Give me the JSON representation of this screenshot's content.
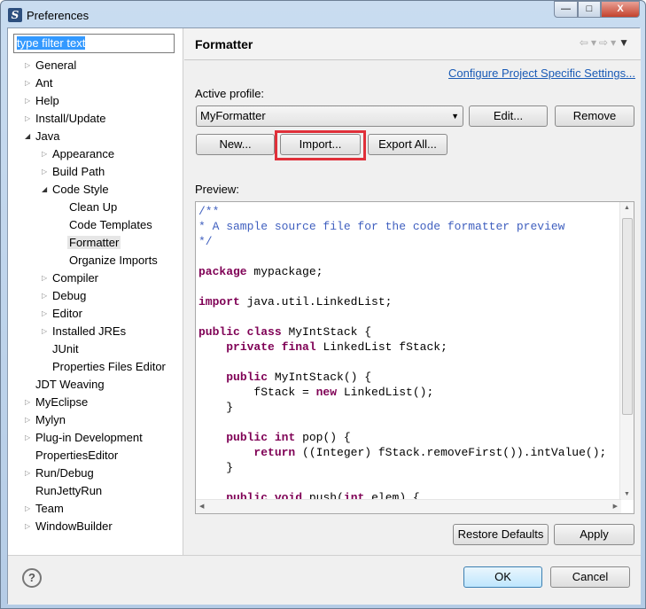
{
  "window": {
    "title": "Preferences",
    "icon": "myeclipse-icon",
    "controls": [
      "minimize",
      "maximize",
      "close"
    ]
  },
  "filter": {
    "value": "type filter text"
  },
  "tree": [
    {
      "label": "General",
      "level": 0,
      "arrow": "collapsed"
    },
    {
      "label": "Ant",
      "level": 0,
      "arrow": "collapsed"
    },
    {
      "label": "Help",
      "level": 0,
      "arrow": "collapsed"
    },
    {
      "label": "Install/Update",
      "level": 0,
      "arrow": "collapsed"
    },
    {
      "label": "Java",
      "level": 0,
      "arrow": "expanded"
    },
    {
      "label": "Appearance",
      "level": 1,
      "arrow": "collapsed"
    },
    {
      "label": "Build Path",
      "level": 1,
      "arrow": "collapsed"
    },
    {
      "label": "Code Style",
      "level": 1,
      "arrow": "expanded"
    },
    {
      "label": "Clean Up",
      "level": 2,
      "arrow": "none"
    },
    {
      "label": "Code Templates",
      "level": 2,
      "arrow": "none"
    },
    {
      "label": "Formatter",
      "level": 2,
      "arrow": "none",
      "selected": true
    },
    {
      "label": "Organize Imports",
      "level": 2,
      "arrow": "none"
    },
    {
      "label": "Compiler",
      "level": 1,
      "arrow": "collapsed"
    },
    {
      "label": "Debug",
      "level": 1,
      "arrow": "collapsed"
    },
    {
      "label": "Editor",
      "level": 1,
      "arrow": "collapsed"
    },
    {
      "label": "Installed JREs",
      "level": 1,
      "arrow": "collapsed"
    },
    {
      "label": "JUnit",
      "level": 1,
      "arrow": "none"
    },
    {
      "label": "Properties Files Editor",
      "level": 1,
      "arrow": "none"
    },
    {
      "label": "JDT Weaving",
      "level": 0,
      "arrow": "none"
    },
    {
      "label": "MyEclipse",
      "level": 0,
      "arrow": "collapsed"
    },
    {
      "label": "Mylyn",
      "level": 0,
      "arrow": "collapsed"
    },
    {
      "label": "Plug-in Development",
      "level": 0,
      "arrow": "collapsed"
    },
    {
      "label": "PropertiesEditor",
      "level": 0,
      "arrow": "none"
    },
    {
      "label": "Run/Debug",
      "level": 0,
      "arrow": "collapsed"
    },
    {
      "label": "RunJettyRun",
      "level": 0,
      "arrow": "none"
    },
    {
      "label": "Team",
      "level": 0,
      "arrow": "collapsed"
    },
    {
      "label": "WindowBuilder",
      "level": 0,
      "arrow": "collapsed"
    }
  ],
  "page": {
    "title": "Formatter",
    "configure_link": "Configure Project Specific Settings...",
    "active_profile_label": "Active profile:",
    "profile_value": "MyFormatter",
    "edit": "Edit...",
    "remove": "Remove",
    "new": "New...",
    "import": "Import...",
    "export_all": "Export All...",
    "preview_label": "Preview:",
    "restore_defaults": "Restore Defaults",
    "apply": "Apply",
    "highlight_color": "#e0303a"
  },
  "code": [
    [
      [
        "cm",
        "/**"
      ]
    ],
    [
      [
        "cm",
        "* A sample source file for the code formatter preview"
      ]
    ],
    [
      [
        "cm",
        "*/"
      ]
    ],
    [],
    [
      [
        "kw",
        "package"
      ],
      [
        "",
        "mypackage;"
      ]
    ],
    [],
    [
      [
        "kw",
        "import"
      ],
      [
        "",
        "java.util.LinkedList;"
      ]
    ],
    [],
    [
      [
        "kw",
        "public"
      ],
      [
        "kw",
        "class"
      ],
      [
        "",
        "MyIntStack {"
      ]
    ],
    [
      [
        "",
        "    "
      ],
      [
        "kw",
        "private"
      ],
      [
        "kw",
        "final"
      ],
      [
        "",
        "LinkedList fStack;"
      ]
    ],
    [],
    [
      [
        "",
        "    "
      ],
      [
        "kw",
        "public"
      ],
      [
        "",
        "MyIntStack() {"
      ]
    ],
    [
      [
        "",
        "        fStack = "
      ],
      [
        "kw",
        "new"
      ],
      [
        "",
        "LinkedList();"
      ]
    ],
    [
      [
        "",
        "    }"
      ]
    ],
    [],
    [
      [
        "",
        "    "
      ],
      [
        "kw",
        "public"
      ],
      [
        "kw",
        "int"
      ],
      [
        "",
        "pop() {"
      ]
    ],
    [
      [
        "",
        "        "
      ],
      [
        "kw",
        "return"
      ],
      [
        "",
        "((Integer) fStack.removeFirst()).intValue();"
      ]
    ],
    [
      [
        "",
        "    }"
      ]
    ],
    [],
    [
      [
        "",
        "    "
      ],
      [
        "kw",
        "public"
      ],
      [
        "kw",
        "void"
      ],
      [
        "",
        "push("
      ],
      [
        "kw",
        "int"
      ],
      [
        "",
        "elem) {"
      ]
    ]
  ],
  "footer": {
    "ok": "OK",
    "cancel": "Cancel",
    "help_icon": "help-icon"
  }
}
